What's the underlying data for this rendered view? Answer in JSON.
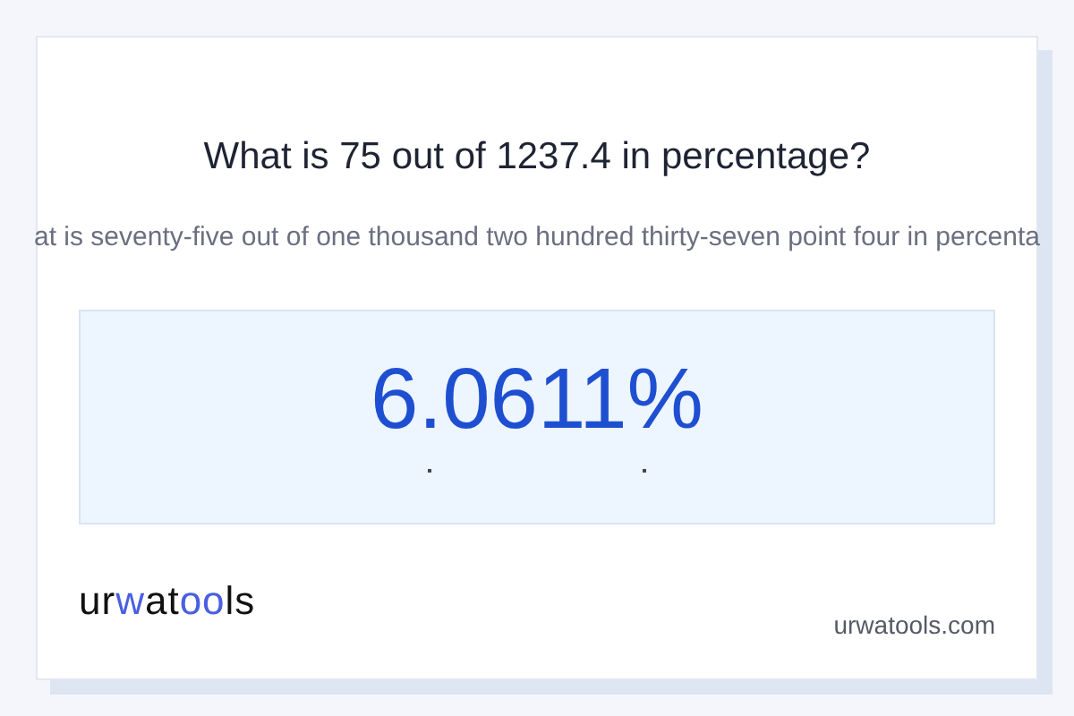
{
  "title": "What is 75 out of 1237.4 in percentage?",
  "subtitle": "at is seventy-five out of one thousand two hundred thirty-seven point four in percenta",
  "result": "6.0611%",
  "logo": [
    {
      "text": "ur",
      "accent": false
    },
    {
      "text": "w",
      "accent": true
    },
    {
      "text": "at",
      "accent": false
    },
    {
      "text": "oo",
      "accent": true
    },
    {
      "text": "ls",
      "accent": false
    }
  ],
  "domain": "urwatools.com"
}
